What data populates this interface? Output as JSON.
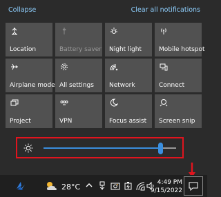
{
  "header": {
    "collapse_label": "Collapse",
    "clear_label": "Clear all notifications"
  },
  "tiles": [
    {
      "label": "Location",
      "icon": "location-icon",
      "enabled": true
    },
    {
      "label": "Battery saver",
      "icon": "battery-saver-icon",
      "enabled": false
    },
    {
      "label": "Night light",
      "icon": "night-light-icon",
      "enabled": true
    },
    {
      "label": "Mobile hotspot",
      "icon": "hotspot-icon",
      "enabled": true
    },
    {
      "label": "Airplane mode",
      "icon": "airplane-icon",
      "enabled": true
    },
    {
      "label": "All settings",
      "icon": "gear-icon",
      "enabled": true
    },
    {
      "label": "Network",
      "icon": "network-icon",
      "enabled": true
    },
    {
      "label": "Connect",
      "icon": "connect-icon",
      "enabled": true
    },
    {
      "label": "Project",
      "icon": "project-icon",
      "enabled": true
    },
    {
      "label": "VPN",
      "icon": "vpn-icon",
      "enabled": true
    },
    {
      "label": "Focus assist",
      "icon": "moon-icon",
      "enabled": true
    },
    {
      "label": "Screen snip",
      "icon": "screen-snip-icon",
      "enabled": true
    }
  ],
  "brightness": {
    "icon": "sun-icon",
    "level": 0.88,
    "accent": "#3a8fe0",
    "highlight": "#e0141e"
  },
  "taskbar": {
    "temperature": "28°C",
    "time": "4:49 PM",
    "date": "9/15/2022",
    "icons": [
      "app-icon",
      "weather-icon",
      "chevron-up-icon",
      "usb-icon",
      "camera-icon",
      "battery-icon",
      "wifi-icon",
      "volume-icon",
      "notification-icon"
    ]
  }
}
